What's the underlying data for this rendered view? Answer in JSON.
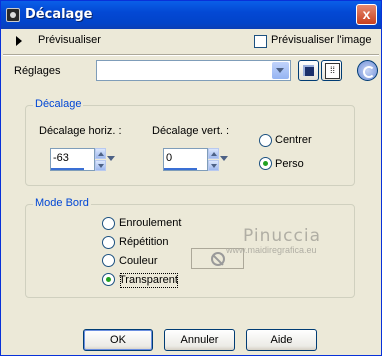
{
  "window": {
    "title": "Décalage",
    "close_glyph": "x"
  },
  "preview": {
    "label": "Prévisualiser",
    "preview_image_label": "Prévisualiser l'image",
    "preview_image_checked": false
  },
  "reglages": {
    "label": "Réglages",
    "value": ""
  },
  "offset_group": {
    "legend": "Décalage",
    "horiz_label": "Décalage horiz. :",
    "horiz_value": "-63",
    "vert_label": "Décalage vert.  :",
    "vert_value": "0",
    "options": [
      {
        "label": "Centrer",
        "selected": false
      },
      {
        "label": "Perso",
        "selected": true
      }
    ]
  },
  "mode_group": {
    "legend": "Mode Bord",
    "options": [
      {
        "label": "Enroulement",
        "selected": false
      },
      {
        "label": "Répétition",
        "selected": false
      },
      {
        "label": "Couleur",
        "selected": false
      },
      {
        "label": "Transparent",
        "selected": true
      }
    ]
  },
  "watermark": {
    "title": "Pinuccia",
    "url": "www.maidiregrafica.eu"
  },
  "buttons": {
    "ok": "OK",
    "cancel": "Annuler",
    "help": "Aide"
  }
}
